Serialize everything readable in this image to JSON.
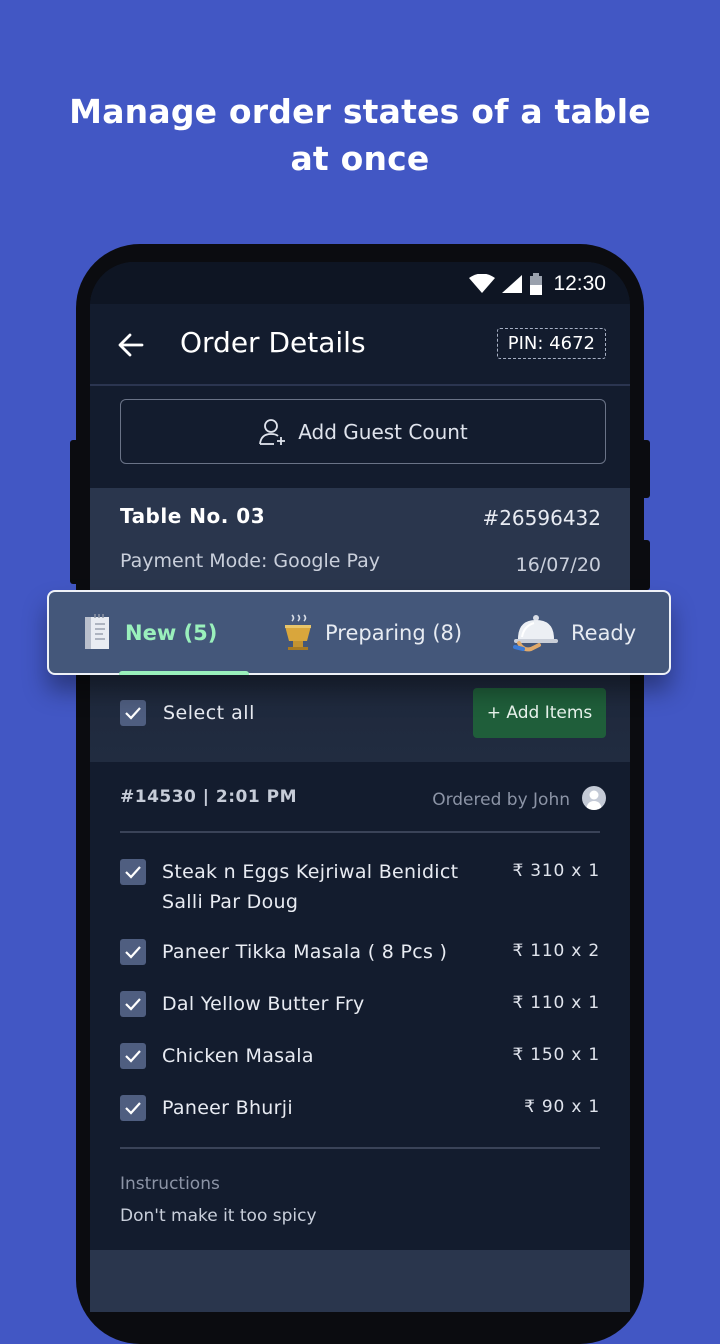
{
  "headline": "Manage order states of a table at once",
  "status_bar": {
    "time": "12:30",
    "icons": [
      "wifi-icon",
      "signal-icon",
      "battery-icon"
    ]
  },
  "app_bar": {
    "title": "Order Details",
    "pin": "PIN: 4672",
    "back_icon": "arrow-left-icon"
  },
  "guest": {
    "label": "Add Guest Count",
    "icon": "add-user-icon"
  },
  "table_card": {
    "table_no": "Table No. 03",
    "order_id": "#26596432",
    "payment_mode": "Payment Mode: Google Pay",
    "date": "16/07/20"
  },
  "tabs": [
    {
      "label": "New (5)",
      "icon": "receipt-icon",
      "active": true
    },
    {
      "label": "Preparing (8)",
      "icon": "steaming-bowl-icon",
      "active": false
    },
    {
      "label": "Ready",
      "icon": "serving-cloche-icon",
      "active": false
    }
  ],
  "select_all": {
    "label": "Select all",
    "checked": true
  },
  "add_items": {
    "label": "+ Add Items"
  },
  "order": {
    "header": "#14530 | 2:01 PM",
    "ordered_by": "Ordered by John",
    "items": [
      {
        "name": "Steak n Eggs Kejriwal Benidict Salli Par Doug",
        "price": "₹ 310 x 1",
        "checked": true
      },
      {
        "name": "Paneer Tikka Masala ( 8 Pcs )",
        "price": "₹ 110 x 2",
        "checked": true
      },
      {
        "name": "Dal Yellow Butter Fry",
        "price": "₹ 110 x 1",
        "checked": true
      },
      {
        "name": "Chicken Masala",
        "price": "₹ 150 x 1",
        "checked": true
      },
      {
        "name": "Paneer Bhurji",
        "price": "₹ 90 x 1",
        "checked": true
      }
    ],
    "instructions_label": "Instructions",
    "instructions": "Don't make it too spicy"
  },
  "colors": {
    "background": "#4257c4",
    "screen": "#131c2e",
    "accent_green": "#9af0bc",
    "add_items_bg": "#1f5e3a"
  }
}
